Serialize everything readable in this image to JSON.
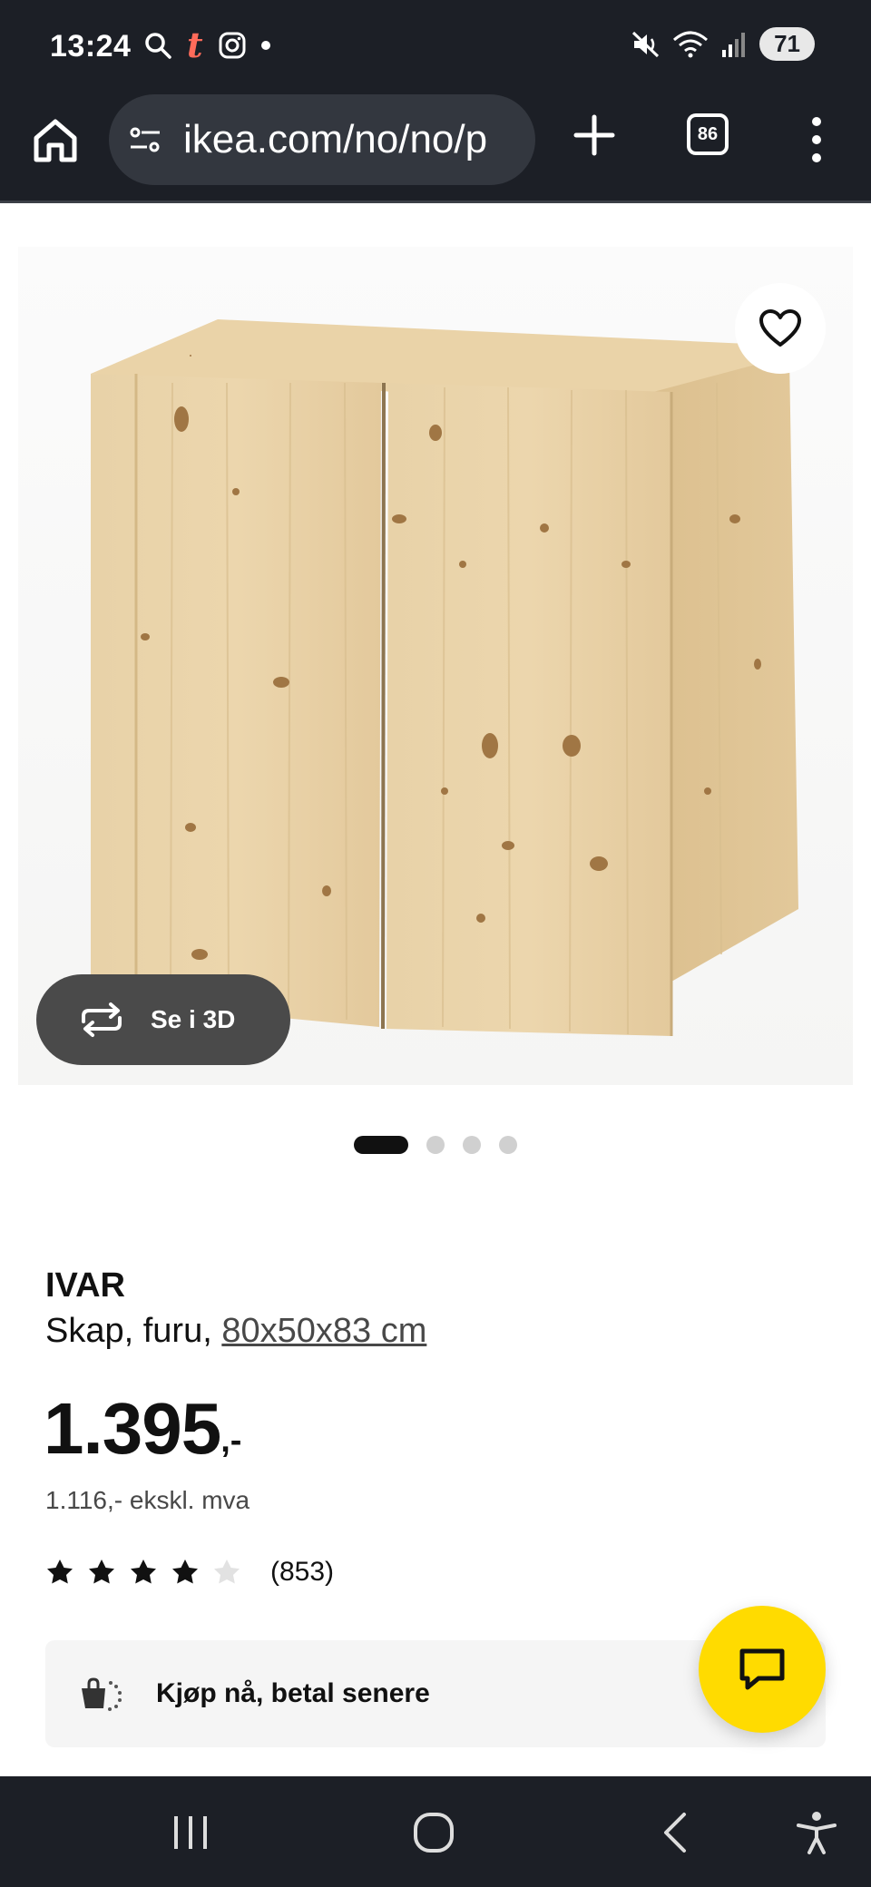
{
  "status_bar": {
    "time": "13:24",
    "battery": "71",
    "icons_left": [
      "search-icon",
      "tumblr-icon",
      "instagram-icon",
      "notification-dot"
    ],
    "icons_right": [
      "mute-icon",
      "wifi-icon",
      "signal-icon",
      "battery-icon"
    ],
    "tumblr_glyph": "t"
  },
  "browser": {
    "url": "ikea.com/no/no/p",
    "tab_count": "86",
    "icons": [
      "home-icon",
      "site-settings-icon",
      "new-tab-icon",
      "tabs-icon",
      "more-icon"
    ]
  },
  "gallery": {
    "see_3d_label": "Se i 3D",
    "dot_count": 4,
    "active_dot": 0,
    "colors": {
      "wood": "#e2c79a",
      "button_bg": "#4a4a4a"
    }
  },
  "product": {
    "name": "IVAR",
    "description_prefix": "Skap, furu, ",
    "size": "80x50x83 cm",
    "price": "1.395",
    "price_suffix": ",-",
    "price_ex_vat": "1.116,- ekskl. mva",
    "rating": 4,
    "rating_max": 5,
    "review_count": "(853)"
  },
  "pay_later": {
    "label": "Kjøp nå, betal senere"
  },
  "chat": {
    "color": "#ffdb00"
  },
  "nav_bar": {
    "icons": [
      "recents-icon",
      "home-circle-icon",
      "back-icon",
      "accessibility-icon"
    ]
  }
}
